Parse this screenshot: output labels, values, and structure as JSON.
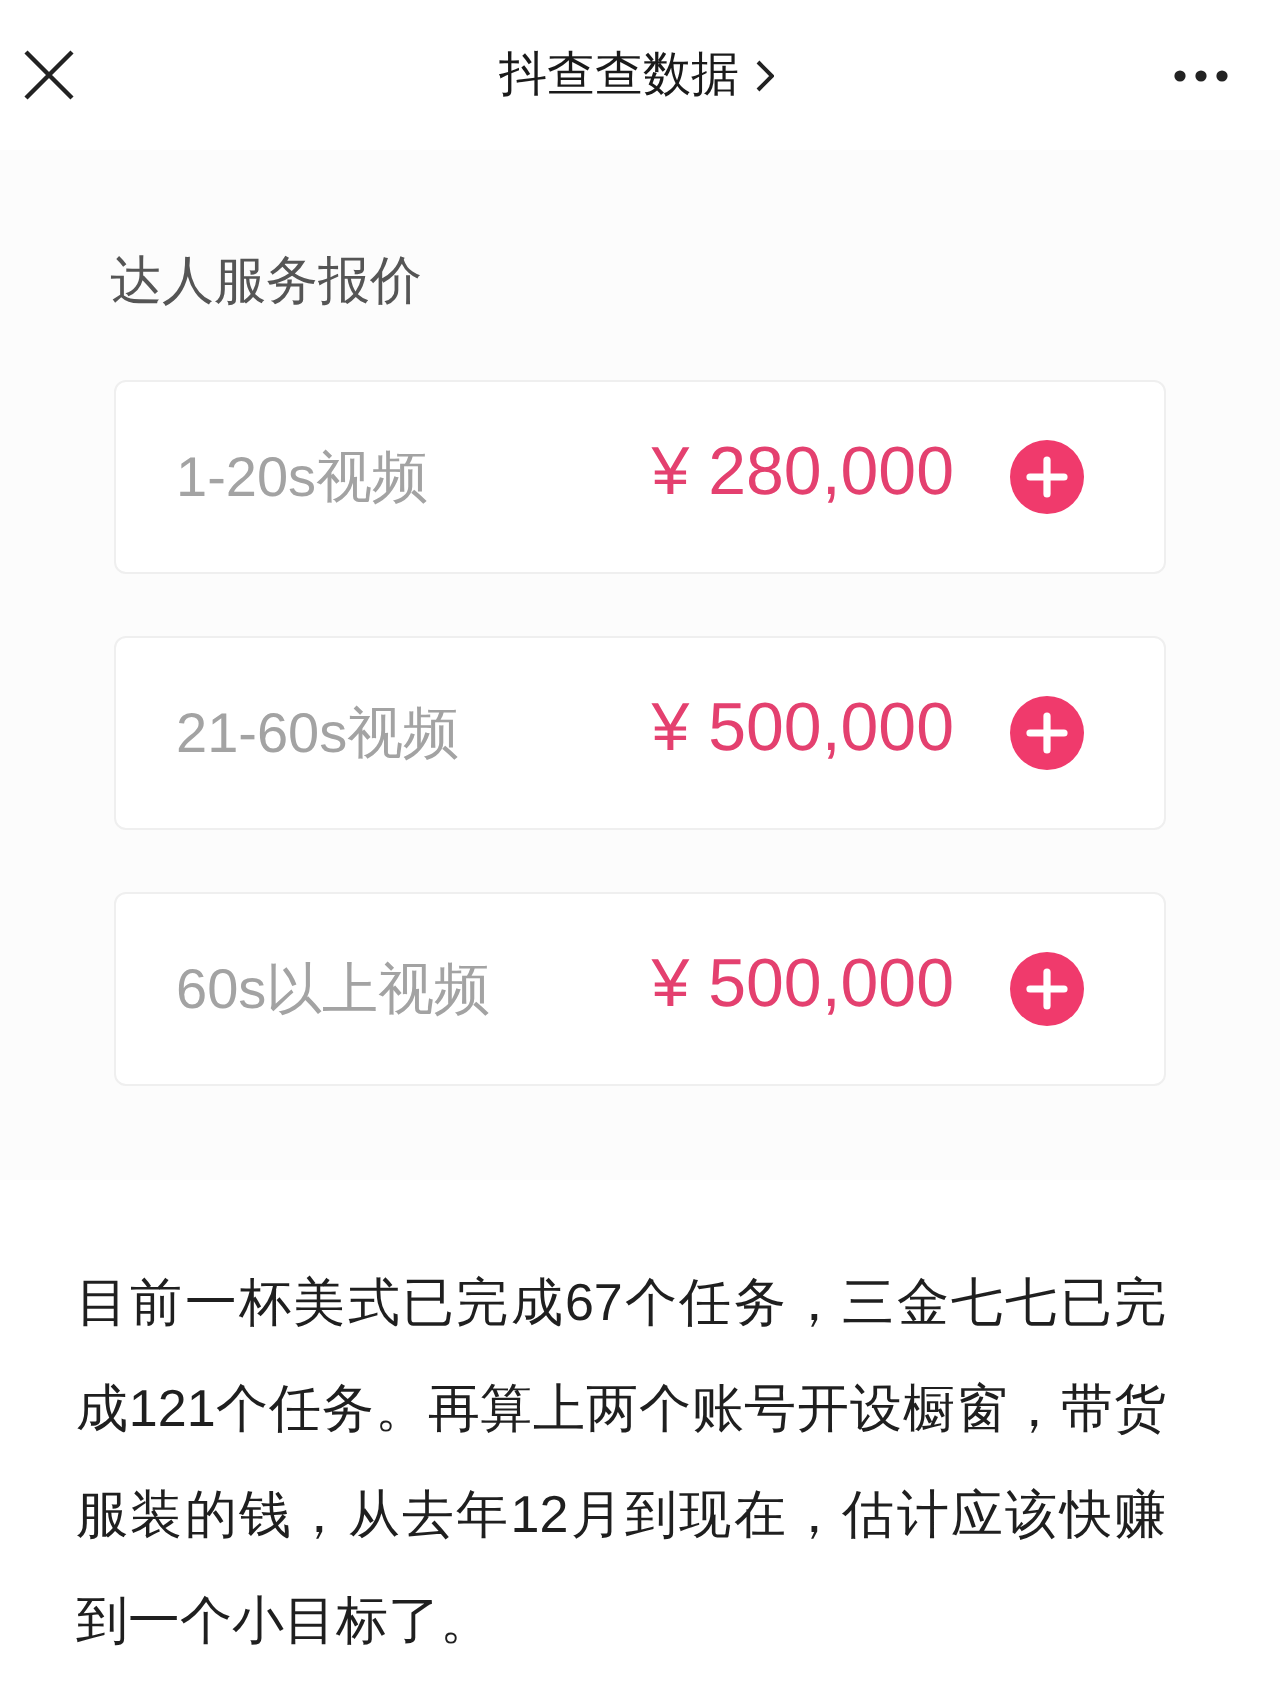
{
  "nav_bar": {
    "title": "抖查查数据"
  },
  "price_section": {
    "heading": "达人服务报价",
    "items": [
      {
        "label": "1-20s视频",
        "price": "¥ 280,000"
      },
      {
        "label": "21-60s视频",
        "price": "¥ 500,000"
      },
      {
        "label": "60s以上视频",
        "price": "¥ 500,000"
      }
    ]
  },
  "article": {
    "paragraph": "目前一杯美式已完成67个任务，三金七七已完成121个任务。再算上两个账号开设橱窗，带货服装的钱，从去年12月到现在，估计应该快赚到一个小目标了。"
  }
}
